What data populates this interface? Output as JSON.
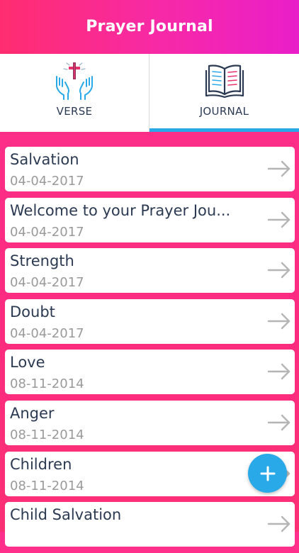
{
  "header": {
    "title": "Prayer Journal"
  },
  "tabs": [
    {
      "label": "VERSE",
      "icon": "praying-hands-cross-icon",
      "active": false
    },
    {
      "label": "JOURNAL",
      "icon": "open-book-icon",
      "active": true
    }
  ],
  "entries": [
    {
      "title": "Salvation",
      "date": "04-04-2017"
    },
    {
      "title": "Welcome to your Prayer Jou...",
      "date": "04-04-2017"
    },
    {
      "title": "Strength",
      "date": "04-04-2017"
    },
    {
      "title": "Doubt",
      "date": "04-04-2017"
    },
    {
      "title": "Love",
      "date": "08-11-2014"
    },
    {
      "title": "Anger",
      "date": "08-11-2014"
    },
    {
      "title": "Children",
      "date": "08-11-2014"
    },
    {
      "title": "Child Salvation",
      "date": ""
    }
  ],
  "fab": {
    "icon": "plus-icon"
  },
  "colors": {
    "header_gradient_start": "#ff2d6f",
    "header_gradient_end": "#e91ec9",
    "background": "#fb2c80",
    "accent": "#2aa9e8",
    "text": "#2b3a52",
    "date_text": "#9a9a9a"
  }
}
